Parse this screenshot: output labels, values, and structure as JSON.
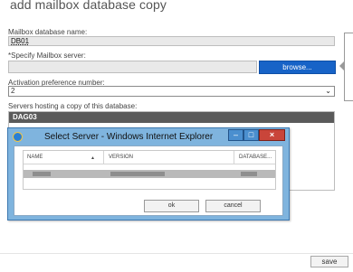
{
  "page": {
    "title": "add mailbox database copy"
  },
  "form": {
    "db_name_label": "Mailbox database name:",
    "db_name_value": "DB01",
    "server_label": "*Specify Mailbox server:",
    "server_value": "",
    "browse_label": "browse...",
    "activation_label": "Activation preference number:",
    "activation_value": "2",
    "servers_label": "Servers hosting a copy of this database:",
    "servers_header": "DAG03"
  },
  "dialog": {
    "title": "Select Server - Windows Internet Explorer",
    "columns": [
      "NAME",
      "VERSION",
      "DATABASE..."
    ],
    "sort_indicator": "▲",
    "ok_label": "ok",
    "cancel_label": "cancel",
    "window_buttons": [
      "–",
      "□",
      "×"
    ]
  },
  "footer": {
    "save_label": "save"
  }
}
